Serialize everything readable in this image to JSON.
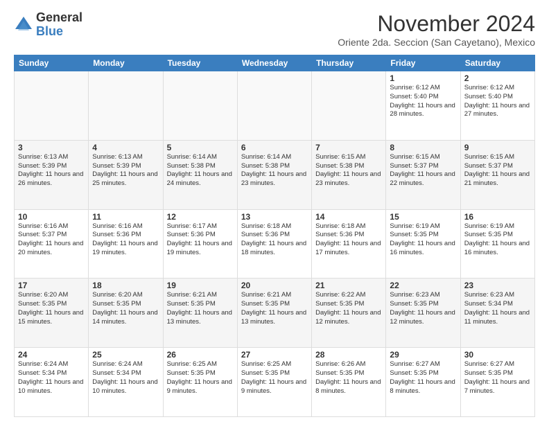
{
  "logo": {
    "general": "General",
    "blue": "Blue"
  },
  "title": "November 2024",
  "subtitle": "Oriente 2da. Seccion (San Cayetano), Mexico",
  "days_of_week": [
    "Sunday",
    "Monday",
    "Tuesday",
    "Wednesday",
    "Thursday",
    "Friday",
    "Saturday"
  ],
  "weeks": [
    [
      {
        "day": "",
        "info": ""
      },
      {
        "day": "",
        "info": ""
      },
      {
        "day": "",
        "info": ""
      },
      {
        "day": "",
        "info": ""
      },
      {
        "day": "",
        "info": ""
      },
      {
        "day": "1",
        "info": "Sunrise: 6:12 AM\nSunset: 5:40 PM\nDaylight: 11 hours and 28 minutes."
      },
      {
        "day": "2",
        "info": "Sunrise: 6:12 AM\nSunset: 5:40 PM\nDaylight: 11 hours and 27 minutes."
      }
    ],
    [
      {
        "day": "3",
        "info": "Sunrise: 6:13 AM\nSunset: 5:39 PM\nDaylight: 11 hours and 26 minutes."
      },
      {
        "day": "4",
        "info": "Sunrise: 6:13 AM\nSunset: 5:39 PM\nDaylight: 11 hours and 25 minutes."
      },
      {
        "day": "5",
        "info": "Sunrise: 6:14 AM\nSunset: 5:38 PM\nDaylight: 11 hours and 24 minutes."
      },
      {
        "day": "6",
        "info": "Sunrise: 6:14 AM\nSunset: 5:38 PM\nDaylight: 11 hours and 23 minutes."
      },
      {
        "day": "7",
        "info": "Sunrise: 6:15 AM\nSunset: 5:38 PM\nDaylight: 11 hours and 23 minutes."
      },
      {
        "day": "8",
        "info": "Sunrise: 6:15 AM\nSunset: 5:37 PM\nDaylight: 11 hours and 22 minutes."
      },
      {
        "day": "9",
        "info": "Sunrise: 6:15 AM\nSunset: 5:37 PM\nDaylight: 11 hours and 21 minutes."
      }
    ],
    [
      {
        "day": "10",
        "info": "Sunrise: 6:16 AM\nSunset: 5:37 PM\nDaylight: 11 hours and 20 minutes."
      },
      {
        "day": "11",
        "info": "Sunrise: 6:16 AM\nSunset: 5:36 PM\nDaylight: 11 hours and 19 minutes."
      },
      {
        "day": "12",
        "info": "Sunrise: 6:17 AM\nSunset: 5:36 PM\nDaylight: 11 hours and 19 minutes."
      },
      {
        "day": "13",
        "info": "Sunrise: 6:18 AM\nSunset: 5:36 PM\nDaylight: 11 hours and 18 minutes."
      },
      {
        "day": "14",
        "info": "Sunrise: 6:18 AM\nSunset: 5:36 PM\nDaylight: 11 hours and 17 minutes."
      },
      {
        "day": "15",
        "info": "Sunrise: 6:19 AM\nSunset: 5:35 PM\nDaylight: 11 hours and 16 minutes."
      },
      {
        "day": "16",
        "info": "Sunrise: 6:19 AM\nSunset: 5:35 PM\nDaylight: 11 hours and 16 minutes."
      }
    ],
    [
      {
        "day": "17",
        "info": "Sunrise: 6:20 AM\nSunset: 5:35 PM\nDaylight: 11 hours and 15 minutes."
      },
      {
        "day": "18",
        "info": "Sunrise: 6:20 AM\nSunset: 5:35 PM\nDaylight: 11 hours and 14 minutes."
      },
      {
        "day": "19",
        "info": "Sunrise: 6:21 AM\nSunset: 5:35 PM\nDaylight: 11 hours and 13 minutes."
      },
      {
        "day": "20",
        "info": "Sunrise: 6:21 AM\nSunset: 5:35 PM\nDaylight: 11 hours and 13 minutes."
      },
      {
        "day": "21",
        "info": "Sunrise: 6:22 AM\nSunset: 5:35 PM\nDaylight: 11 hours and 12 minutes."
      },
      {
        "day": "22",
        "info": "Sunrise: 6:23 AM\nSunset: 5:35 PM\nDaylight: 11 hours and 12 minutes."
      },
      {
        "day": "23",
        "info": "Sunrise: 6:23 AM\nSunset: 5:34 PM\nDaylight: 11 hours and 11 minutes."
      }
    ],
    [
      {
        "day": "24",
        "info": "Sunrise: 6:24 AM\nSunset: 5:34 PM\nDaylight: 11 hours and 10 minutes."
      },
      {
        "day": "25",
        "info": "Sunrise: 6:24 AM\nSunset: 5:34 PM\nDaylight: 11 hours and 10 minutes."
      },
      {
        "day": "26",
        "info": "Sunrise: 6:25 AM\nSunset: 5:35 PM\nDaylight: 11 hours and 9 minutes."
      },
      {
        "day": "27",
        "info": "Sunrise: 6:25 AM\nSunset: 5:35 PM\nDaylight: 11 hours and 9 minutes."
      },
      {
        "day": "28",
        "info": "Sunrise: 6:26 AM\nSunset: 5:35 PM\nDaylight: 11 hours and 8 minutes."
      },
      {
        "day": "29",
        "info": "Sunrise: 6:27 AM\nSunset: 5:35 PM\nDaylight: 11 hours and 8 minutes."
      },
      {
        "day": "30",
        "info": "Sunrise: 6:27 AM\nSunset: 5:35 PM\nDaylight: 11 hours and 7 minutes."
      }
    ]
  ]
}
